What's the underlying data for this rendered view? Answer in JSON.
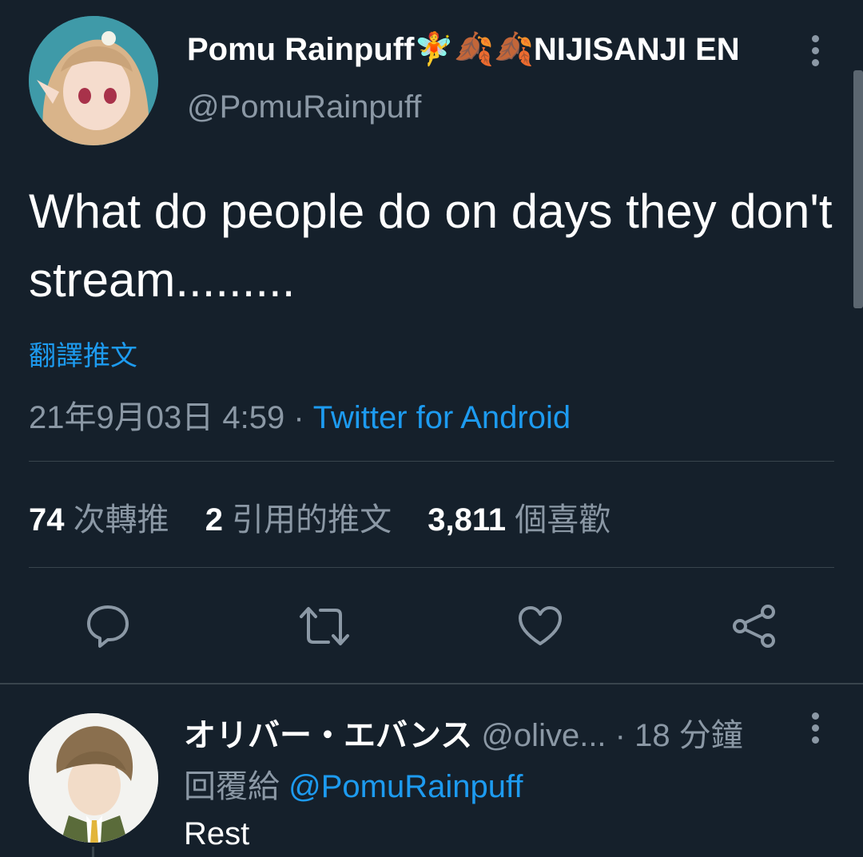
{
  "tweet": {
    "author_name": "Pomu Rainpuff",
    "author_emoji": "🧚🍂🍂",
    "author_suffix": "NIJISANJI EN",
    "handle": "@PomuRainpuff",
    "text": "What do people do on days they don't stream.........",
    "translate_label": "翻譯推文",
    "date": "21年9月03日 4:59",
    "separator": " · ",
    "source": "Twitter for Android",
    "stats": {
      "retweets_count": "74",
      "retweets_label": "次轉推",
      "quotes_count": "2",
      "quotes_label": "引用的推文",
      "likes_count": "3,811",
      "likes_label": "個喜歡"
    }
  },
  "actions": [
    {
      "name": "reply",
      "icon": "speech-bubble-icon"
    },
    {
      "name": "retweet",
      "icon": "retweet-icon"
    },
    {
      "name": "like",
      "icon": "heart-icon"
    },
    {
      "name": "share",
      "icon": "share-icon"
    }
  ],
  "reply": {
    "author_name": "オリバー・エバンス",
    "handle": "@olive...",
    "time": "· 18 分鐘",
    "replying_to_label": "回覆給",
    "replying_to": "@PomuRainpuff",
    "text": "Rest"
  },
  "colors": {
    "background": "#15202b",
    "accent": "#1d9bf0",
    "muted": "#8b98a5",
    "divider": "#38444d"
  }
}
